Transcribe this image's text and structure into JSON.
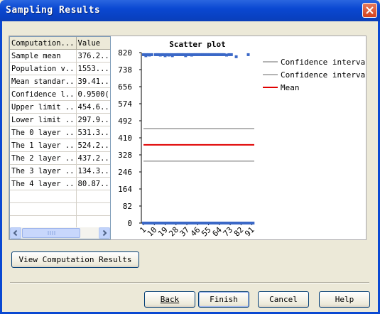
{
  "window": {
    "title": "Sampling Results"
  },
  "table": {
    "columns": [
      "Computation...",
      "Value"
    ],
    "rows": [
      [
        "Sample mean",
        "376.2..."
      ],
      [
        "Population v...",
        "1553..."
      ],
      [
        "Mean standar...",
        "39.41..."
      ],
      [
        "Confidence l...",
        "0.9500("
      ],
      [
        "Upper limit ...",
        "454.6..."
      ],
      [
        "Lower limit ...",
        "297.9..."
      ],
      [
        "The 0 layer ...",
        "531.3..."
      ],
      [
        "The 1 layer ...",
        "524.2..."
      ],
      [
        "The 2 layer ...",
        "437.2..."
      ],
      [
        "The 3 layer ...",
        "134.3..."
      ],
      [
        "The 4 layer ...",
        "80.87..."
      ],
      [
        "",
        ""
      ],
      [
        "",
        ""
      ],
      [
        "",
        ""
      ]
    ]
  },
  "chart_data": {
    "type": "scatter",
    "title": "Scatter plot",
    "ylim": [
      0,
      820
    ],
    "yticks": [
      "820",
      "738",
      "656",
      "574",
      "492",
      "410",
      "328",
      "246",
      "164",
      "82",
      "0"
    ],
    "xlim": [
      1,
      93
    ],
    "xticks": [
      "1",
      "10",
      "19",
      "28",
      "37",
      "46",
      "55",
      "64",
      "73",
      "82",
      "91"
    ],
    "series": [
      {
        "name": "",
        "color": "#3b68c7",
        "x": [
          1,
          2,
          3,
          4,
          5,
          6,
          7,
          8,
          11,
          12,
          13,
          14,
          15,
          16,
          17,
          18,
          19,
          20,
          21,
          22,
          23,
          24,
          25,
          26,
          28,
          29,
          30,
          31,
          32,
          33,
          34,
          35,
          36,
          37,
          38,
          39,
          40,
          41,
          42,
          43,
          44,
          45,
          46,
          47,
          48,
          49,
          50,
          51,
          52,
          53,
          54,
          55,
          56,
          57,
          58,
          59,
          60,
          61,
          62,
          63,
          64,
          65,
          66,
          67,
          68,
          70,
          72,
          74,
          78,
          88,
          1,
          2,
          3,
          4,
          5,
          6,
          7,
          8,
          9,
          10,
          11,
          12,
          13,
          14,
          15,
          16,
          17,
          18,
          19,
          20,
          21,
          22,
          23,
          24,
          25,
          26,
          27,
          28,
          29,
          30,
          31,
          32,
          33,
          34,
          35,
          36,
          37,
          38,
          39,
          40,
          41,
          42,
          43,
          44,
          45,
          46,
          47,
          48,
          49,
          50,
          51,
          52,
          53,
          54,
          55,
          56,
          57,
          58,
          59,
          60,
          61,
          62,
          63,
          64,
          65,
          66,
          67,
          68,
          69,
          70,
          71,
          72,
          73,
          74,
          75,
          76,
          77,
          78,
          79,
          80,
          81,
          82,
          83,
          84,
          85,
          86,
          87,
          88,
          89,
          90,
          91,
          92
        ],
        "y": [
          810,
          810,
          805,
          810,
          810,
          808,
          810,
          810,
          810,
          810,
          810,
          810,
          808,
          810,
          810,
          810,
          805,
          810,
          810,
          808,
          810,
          810,
          805,
          810,
          810,
          810,
          810,
          810,
          810,
          810,
          810,
          810,
          805,
          810,
          810,
          810,
          810,
          808,
          810,
          810,
          810,
          810,
          810,
          810,
          810,
          810,
          810,
          810,
          810,
          810,
          810,
          810,
          810,
          810,
          810,
          810,
          810,
          810,
          810,
          810,
          810,
          810,
          810,
          810,
          810,
          808,
          810,
          810,
          800,
          810,
          0,
          0,
          0,
          0,
          0,
          0,
          0,
          0,
          0,
          0,
          0,
          0,
          0,
          0,
          0,
          0,
          0,
          0,
          0,
          0,
          0,
          0,
          0,
          0,
          0,
          0,
          0,
          0,
          0,
          0,
          0,
          0,
          0,
          0,
          0,
          0,
          0,
          0,
          0,
          0,
          0,
          0,
          0,
          0,
          0,
          0,
          0,
          0,
          0,
          0,
          0,
          0,
          0,
          0,
          0,
          0,
          0,
          0,
          0,
          0,
          0,
          0,
          0,
          0,
          0,
          0,
          0,
          0,
          0,
          0,
          0,
          0,
          0,
          0,
          0,
          0,
          0,
          0,
          0,
          0,
          0,
          0,
          0,
          0,
          0,
          0,
          0,
          0,
          0,
          0,
          0,
          0
        ]
      }
    ],
    "lines": [
      {
        "name": "Confidence interval",
        "y": 454.6,
        "color": "#b4b4b4"
      },
      {
        "name": "Confidence interval",
        "y": 297.9,
        "color": "#b4b4b4"
      },
      {
        "name": "Mean",
        "y": 376.2,
        "color": "#e00000"
      }
    ],
    "legend": "right"
  },
  "buttons": {
    "view_results": "View Computation Results",
    "back": "Back",
    "finish": "Finish",
    "cancel": "Cancel",
    "help": "Help"
  }
}
